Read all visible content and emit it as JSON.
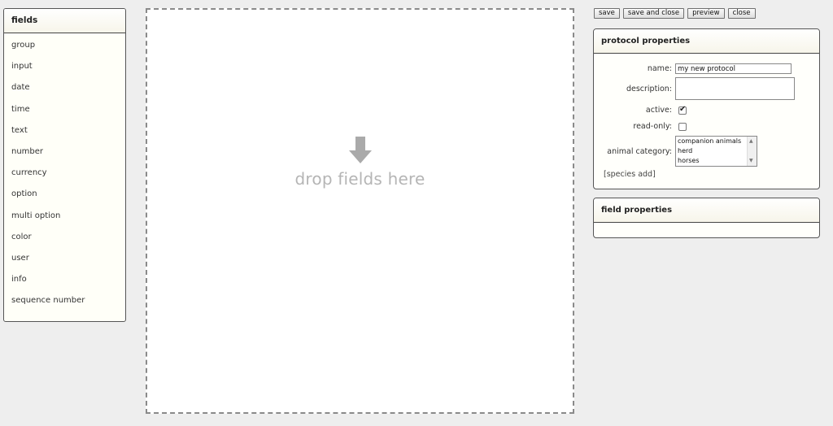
{
  "fields_panel": {
    "title": "fields",
    "items": [
      {
        "label": "group"
      },
      {
        "label": "input"
      },
      {
        "label": "date"
      },
      {
        "label": "time"
      },
      {
        "label": "text"
      },
      {
        "label": "number"
      },
      {
        "label": "currency"
      },
      {
        "label": "option"
      },
      {
        "label": "multi option"
      },
      {
        "label": "color"
      },
      {
        "label": "user"
      },
      {
        "label": "info"
      },
      {
        "label": "sequence number"
      }
    ]
  },
  "drop_zone": {
    "hint": "drop fields here",
    "icon": "arrow-down-icon"
  },
  "toolbar": {
    "save": "save",
    "save_and_close": "save and close",
    "preview": "preview",
    "close": "close"
  },
  "protocol_properties": {
    "title": "protocol properties",
    "name_label": "name:",
    "name_value": "my new protocol",
    "description_label": "description:",
    "description_value": "",
    "active_label": "active:",
    "active_checked": true,
    "readonly_label": "read-only:",
    "readonly_checked": false,
    "animal_category_label": "animal category:",
    "animal_category_options": [
      "companion animals",
      "herd",
      "horses"
    ],
    "species_add": "[species add]"
  },
  "field_properties": {
    "title": "field properties"
  },
  "colors": {
    "background": "#eeeeee",
    "panel": "#fffff8",
    "border": "#555555",
    "hint_text": "#b5b5b5"
  }
}
